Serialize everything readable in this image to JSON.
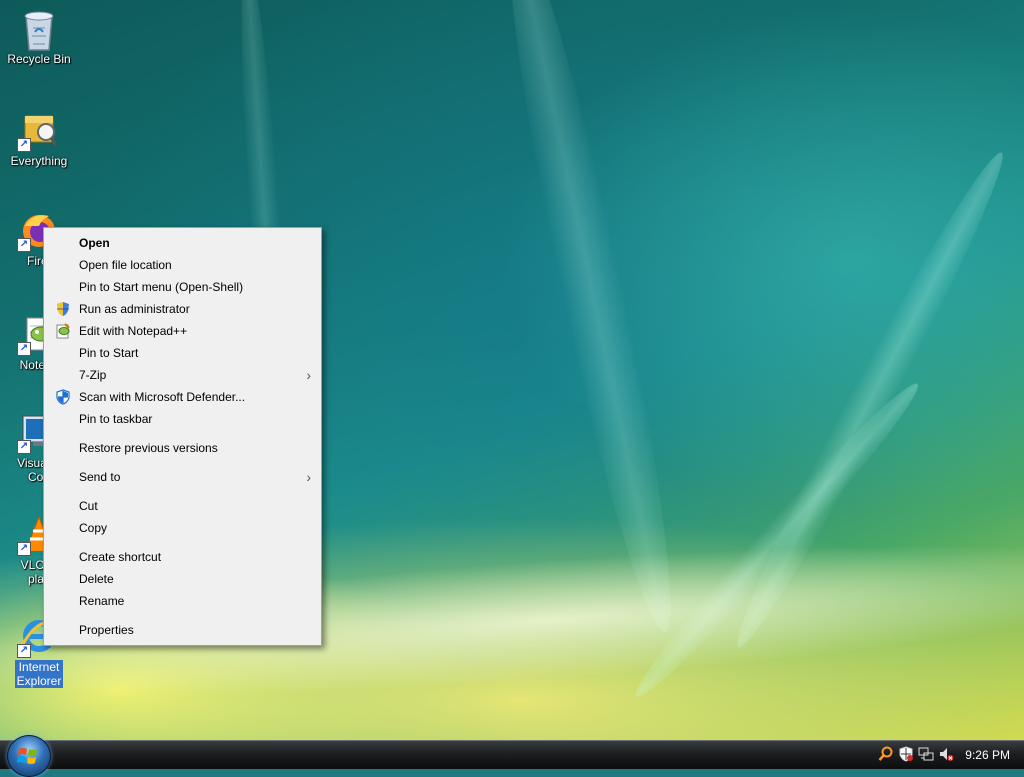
{
  "desktop_icons": [
    {
      "id": "recycle-bin",
      "label": "Recycle Bin",
      "icon": "recycle-bin-icon"
    },
    {
      "id": "everything",
      "label": "Everything",
      "icon": "everything-icon"
    },
    {
      "id": "firefox",
      "label": "Firef",
      "icon": "firefox-icon"
    },
    {
      "id": "notepad",
      "label": "Notepa",
      "icon": "notepad-plus-plus-icon"
    },
    {
      "id": "vscode",
      "label": "Visual S\nCoo",
      "icon": "vscode-icon"
    },
    {
      "id": "vlc",
      "label": "VLC m\nplay",
      "icon": "vlc-icon"
    },
    {
      "id": "internet-explorer",
      "label": "Internet\nExplorer",
      "icon": "internet-explorer-icon",
      "selected": true
    }
  ],
  "context_menu": {
    "items": [
      {
        "label": "Open",
        "bold": true
      },
      {
        "label": "Open file location"
      },
      {
        "label": "Pin to Start menu (Open-Shell)"
      },
      {
        "label": "Run as administrator",
        "icon": "uac-shield-icon"
      },
      {
        "label": "Edit with Notepad++",
        "icon": "notepad-plus-plus-icon"
      },
      {
        "label": "Pin to Start"
      },
      {
        "label": "7-Zip",
        "submenu": true
      },
      {
        "label": "Scan with Microsoft Defender...",
        "icon": "defender-icon"
      },
      {
        "label": "Pin to taskbar"
      },
      {
        "label": "Restore previous versions"
      },
      {
        "label": "Send to",
        "submenu": true
      },
      {
        "label": "Cut"
      },
      {
        "label": "Copy"
      },
      {
        "label": "Create shortcut"
      },
      {
        "label": "Delete"
      },
      {
        "label": "Rename"
      },
      {
        "label": "Properties"
      }
    ]
  },
  "taskbar": {
    "start_button": "windows-logo-icon",
    "tray_icons": [
      "search-icon",
      "security-center-icon",
      "network-icon",
      "volume-muted-icon"
    ],
    "clock": "9:26 PM"
  },
  "colors": {
    "menu_bg": "#f0f0f0",
    "selection": "#3373c8",
    "taskbar": "#1c1e20"
  }
}
